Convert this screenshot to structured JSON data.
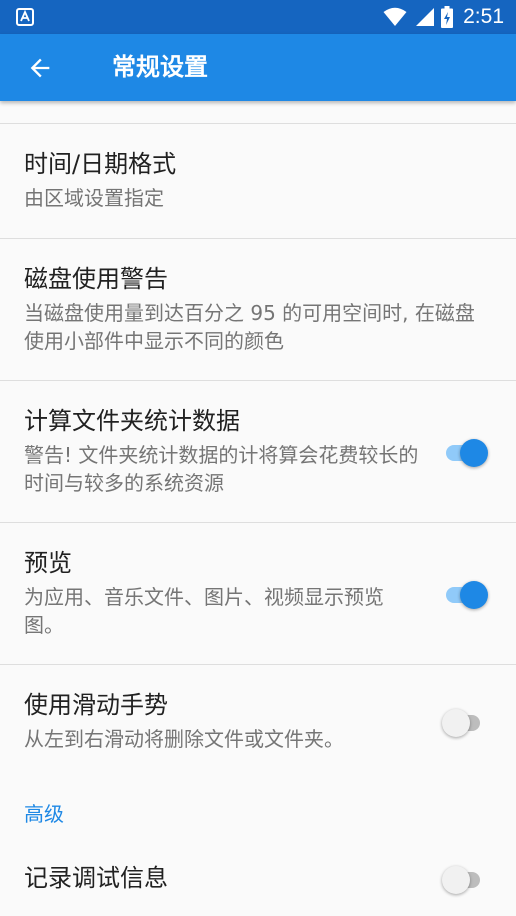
{
  "status_bar": {
    "time": "2:51",
    "icons": [
      "app-notification-icon",
      "wifi-icon",
      "signal-icon",
      "battery-charging-icon"
    ]
  },
  "app_bar": {
    "title": "常规设置",
    "back_icon": "arrow-back-icon"
  },
  "colors": {
    "primary": "#1e88e5",
    "primary_dark": "#1565c0",
    "switch_on_track": "#90caf9",
    "switch_off_track": "#bdbdbd"
  },
  "preferences": [
    {
      "title": "时间/日期格式",
      "summary": "由区域设置指定"
    },
    {
      "title": "磁盘使用警告",
      "summary": "当磁盘使用量到达百分之 95 的可用空间时, 在磁盘使用小部件中显示不同的颜色"
    },
    {
      "title": "计算文件夹统计数据",
      "summary": "警告! 文件夹统计数据的计将算会花费较长的时间与较多的系统资源",
      "switch": true
    },
    {
      "title": "预览",
      "summary": "为应用、音乐文件、图片、视频显示预览图。",
      "switch": true
    },
    {
      "title": "使用滑动手势",
      "summary": "从左到右滑动将删除文件或文件夹。",
      "switch": false
    }
  ],
  "advanced": {
    "category_label": "高级",
    "items": [
      {
        "title": "记录调试信息",
        "switch": false
      }
    ]
  }
}
